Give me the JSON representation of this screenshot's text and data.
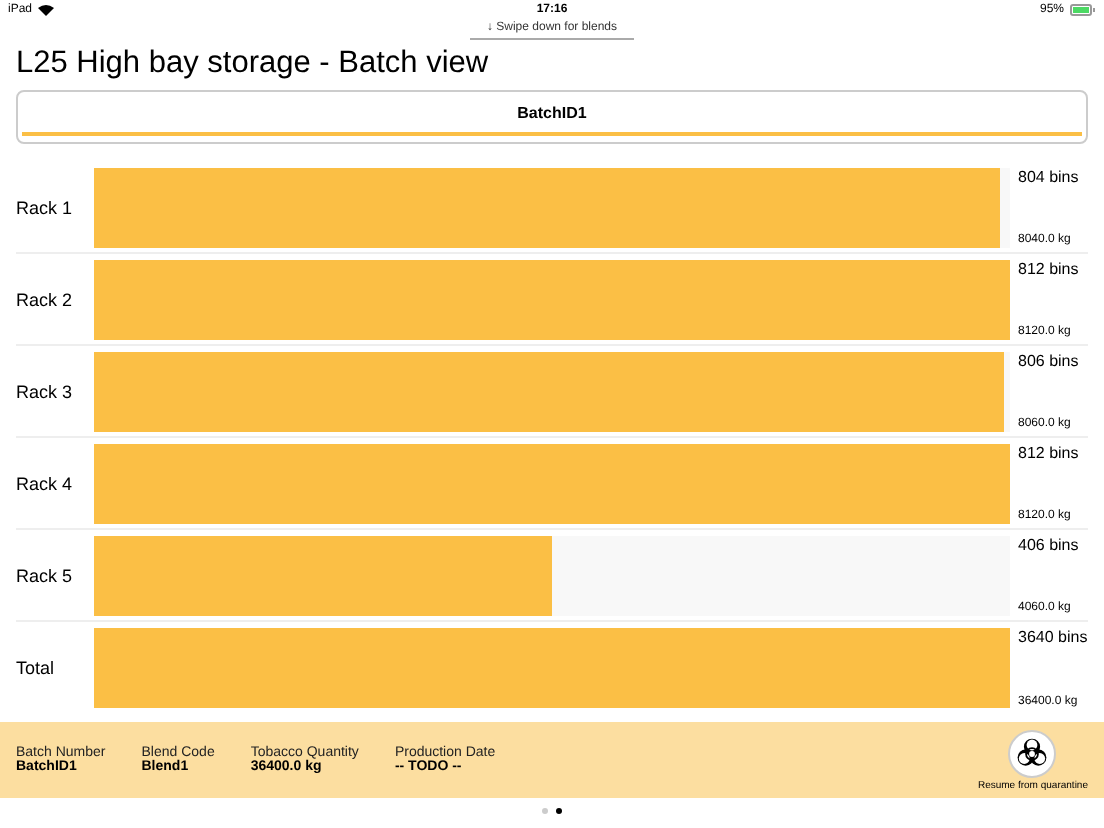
{
  "status_bar": {
    "device": "iPad",
    "time": "17:16",
    "battery": "95%"
  },
  "pull_hint": "↓ Swipe down for blends",
  "title": "L25 High bay storage - Batch view",
  "segment": {
    "label": "BatchID1",
    "selected": true
  },
  "racks": [
    {
      "name": "Rack 1",
      "level": 0.99,
      "bins": "804 bins",
      "weight": "8040.0 kg"
    },
    {
      "name": "Rack 2",
      "level": 1.0,
      "bins": "812 bins",
      "weight": "8120.0 kg"
    },
    {
      "name": "Rack 3",
      "level": 0.993,
      "bins": "806 bins",
      "weight": "8060.0 kg"
    },
    {
      "name": "Rack 4",
      "level": 1.0,
      "bins": "812 bins",
      "weight": "8120.0 kg"
    },
    {
      "name": "Rack 5",
      "level": 0.5,
      "bins": "406 bins",
      "weight": "4060.0 kg"
    },
    {
      "name": "Total",
      "level": 1.0,
      "bins": "3640 bins",
      "weight": "36400.0 kg"
    }
  ],
  "footer": {
    "fields": [
      {
        "label": "Batch Number",
        "value": "BatchID1"
      },
      {
        "label": "Blend Code",
        "value": "Blend1"
      },
      {
        "label": "Tobacco Quantity",
        "value": "36400.0 kg"
      },
      {
        "label": "Production Date",
        "value": "-- TODO --"
      }
    ],
    "action": "Resume from quarantine"
  },
  "pages": [
    {
      "selected": false
    },
    {
      "selected": true
    }
  ]
}
